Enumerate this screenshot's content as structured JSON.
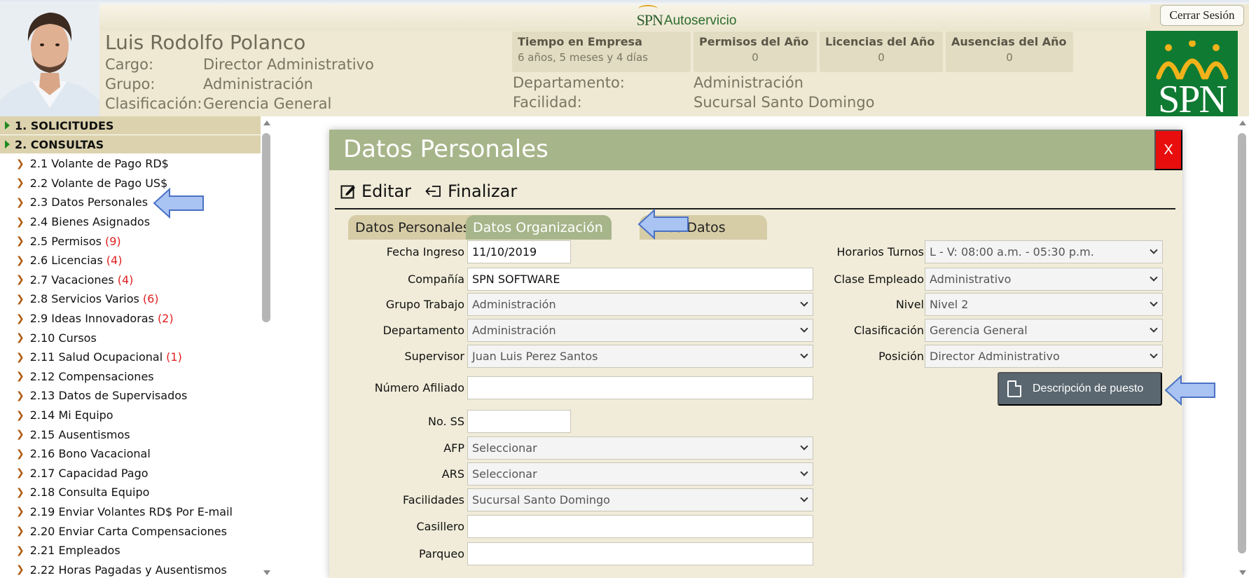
{
  "app": {
    "brand_spn": "SPN",
    "brand_name": "Autoservicio",
    "logout_label": "Cerrar Sesión",
    "logo_text": "SPN"
  },
  "employee": {
    "name": "Luis Rodolfo Polanco",
    "cargo_label": "Cargo:",
    "cargo": "Director Administrativo",
    "grupo_label": "Grupo:",
    "grupo": "Administración",
    "clasificacion_label": "Clasificación:",
    "clasificacion": "Gerencia General",
    "departamento_label": "Departamento:",
    "departamento": "Administración",
    "facilidad_label": "Facilidad:",
    "facilidad": "Sucursal Santo Domingo"
  },
  "stats": [
    {
      "title": "Tiempo en Empresa",
      "value": "6 años, 5 meses y 4 días"
    },
    {
      "title": "Permisos del Año",
      "value": "0"
    },
    {
      "title": "Licencias del Año",
      "value": "0"
    },
    {
      "title": "Ausencias del Año",
      "value": "0"
    }
  ],
  "sidebar": {
    "sections": [
      {
        "label": "1. SOLICITUDES"
      },
      {
        "label": "2. CONSULTAS"
      }
    ],
    "items": [
      {
        "label": "2.1 Volante de Pago RD$",
        "count": ""
      },
      {
        "label": "2.2 Volante de Pago US$",
        "count": ""
      },
      {
        "label": "2.3 Datos Personales",
        "count": ""
      },
      {
        "label": "2.4 Bienes Asignados",
        "count": ""
      },
      {
        "label": "2.5 Permisos",
        "count": "(9)"
      },
      {
        "label": "2.6 Licencias",
        "count": "(4)"
      },
      {
        "label": "2.7 Vacaciones",
        "count": "(4)"
      },
      {
        "label": "2.8 Servicios Varios",
        "count": "(6)"
      },
      {
        "label": "2.9 Ideas Innovadoras",
        "count": "(2)"
      },
      {
        "label": "2.10 Cursos",
        "count": ""
      },
      {
        "label": "2.11 Salud Ocupacional",
        "count": "(1)"
      },
      {
        "label": "2.12 Compensaciones",
        "count": ""
      },
      {
        "label": "2.13 Datos de Supervisados",
        "count": ""
      },
      {
        "label": "2.14 Mi Equipo",
        "count": ""
      },
      {
        "label": "2.15 Ausentismos",
        "count": ""
      },
      {
        "label": "2.16 Bono Vacacional",
        "count": ""
      },
      {
        "label": "2.17 Capacidad Pago",
        "count": ""
      },
      {
        "label": "2.18 Consulta Equipo",
        "count": ""
      },
      {
        "label": "2.19 Enviar Volantes RD$ Por E-mail",
        "count": ""
      },
      {
        "label": "2.20 Enviar Carta Compensaciones",
        "count": ""
      },
      {
        "label": "2.21 Empleados",
        "count": ""
      },
      {
        "label": "2.22 Horas Pagadas y Ausentismos",
        "count": ""
      }
    ]
  },
  "dialog": {
    "title": "Datos Personales",
    "close_label": "X",
    "edit_label": "Editar",
    "finish_label": "Finalizar",
    "tabs": [
      {
        "label": "Datos Personales"
      },
      {
        "label": "Datos Organización"
      },
      {
        "label": "Otros Datos"
      }
    ],
    "left_fields": [
      {
        "label": "Fecha Ingreso",
        "value": "11/10/2019",
        "type": "text"
      },
      {
        "label": "Compañía",
        "value": "SPN SOFTWARE",
        "type": "text"
      },
      {
        "label": "Grupo Trabajo",
        "value": "Administración",
        "type": "select"
      },
      {
        "label": "Departamento",
        "value": "Administración",
        "type": "select"
      },
      {
        "label": "Supervisor",
        "value": "Juan Luis Perez Santos",
        "type": "select"
      },
      {
        "label": "Número Afiliado",
        "value": "",
        "type": "text"
      },
      {
        "label": "No. SS",
        "value": "",
        "type": "text"
      },
      {
        "label": "AFP",
        "value": "Seleccionar",
        "type": "select"
      },
      {
        "label": "ARS",
        "value": "Seleccionar",
        "type": "select"
      },
      {
        "label": "Facilidades",
        "value": "Sucursal Santo Domingo",
        "type": "select"
      },
      {
        "label": "Casillero",
        "value": "",
        "type": "text"
      },
      {
        "label": "Parqueo",
        "value": "",
        "type": "text"
      }
    ],
    "right_fields": [
      {
        "label": "Horarios Turnos",
        "value": "L - V: 08:00 a.m. - 05:30 p.m.",
        "type": "select"
      },
      {
        "label": "Clase Empleado",
        "value": "Administrativo",
        "type": "select"
      },
      {
        "label": "Nivel",
        "value": "Nivel 2",
        "type": "select"
      },
      {
        "label": "Clasificación",
        "value": "Gerencia General",
        "type": "select"
      },
      {
        "label": "Posición",
        "value": "Director Administrativo",
        "type": "select"
      }
    ],
    "job_description_label": "Descripción de puesto"
  },
  "colors": {
    "header_bg": "#efe9d3",
    "dialog_title_bg": "#a7b58a",
    "close_bg": "#e80e0e",
    "logo_bg": "#0f7a32",
    "annotation_arrow": "#a9c3f2"
  }
}
